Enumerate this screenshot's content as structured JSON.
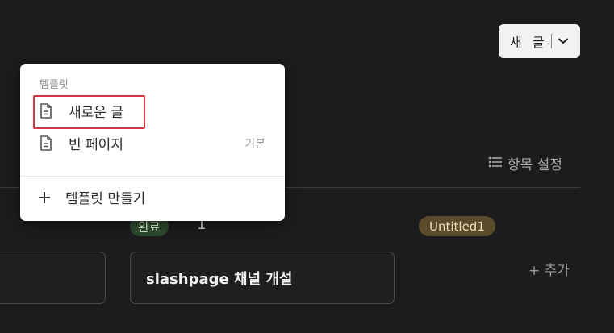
{
  "header": {
    "new_post_label": "새 글"
  },
  "toolbar": {
    "field_settings_label": "항목 설정"
  },
  "board": {
    "columns": [
      {
        "status": "완료",
        "count": "1"
      },
      {
        "status": "Untitled1"
      }
    ],
    "card_title": "slashpage 채널 개설",
    "add_label": "+ 추가"
  },
  "template_menu": {
    "section_label": "템플릿",
    "items": [
      {
        "label": "새로운 글"
      },
      {
        "label": "빈 페이지",
        "hint": "기본"
      }
    ],
    "create_label": "템플릿 만들기"
  },
  "icons": {
    "document": "document-icon",
    "chevron": "chevron-down-icon",
    "list": "list-icon",
    "plus": "plus-icon"
  },
  "colors": {
    "background": "#1c1c1f",
    "highlight": "#d4353f",
    "done_badge": "#2e4a2f",
    "untitled_badge": "#5a4b2a"
  }
}
